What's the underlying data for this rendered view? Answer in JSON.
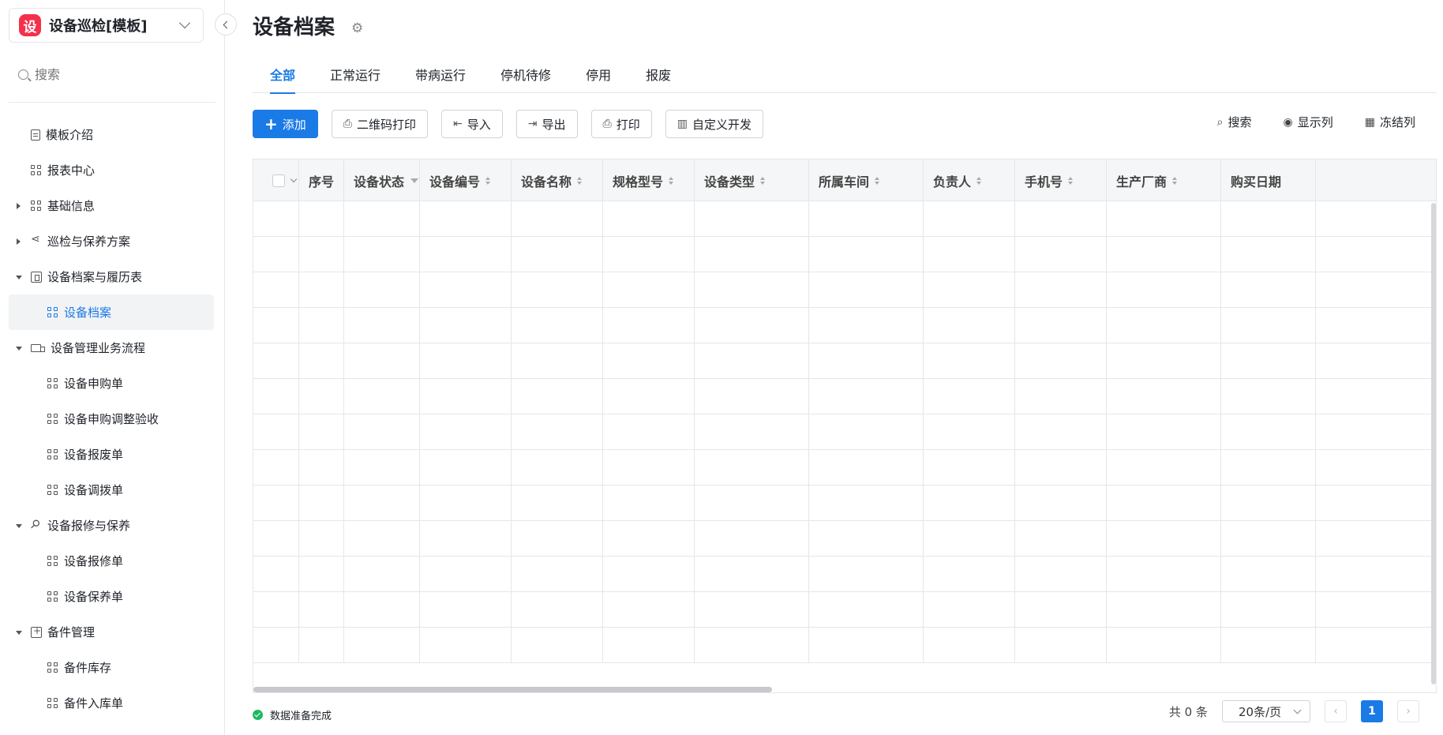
{
  "app": {
    "logo_glyph": "设",
    "name": "设备巡检[模板]",
    "brand_color": "#f5304a",
    "accent_color": "#1a7ae6"
  },
  "sidebar": {
    "search_placeholder": "搜索",
    "items": [
      {
        "label": "模板介绍",
        "level": 1,
        "icon": "document-icon",
        "expand": "none"
      },
      {
        "label": "报表中心",
        "level": 1,
        "icon": "grid-icon",
        "expand": "none"
      },
      {
        "label": "基础信息",
        "level": 1,
        "icon": "grid-icon",
        "expand": "collapsed"
      },
      {
        "label": "巡检与保养方案",
        "level": 1,
        "icon": "share-icon",
        "expand": "collapsed"
      },
      {
        "label": "设备档案与履历表",
        "level": 1,
        "icon": "file-icon",
        "expand": "expanded"
      },
      {
        "label": "设备档案",
        "level": 2,
        "icon": "grid-icon",
        "expand": "none",
        "active": true
      },
      {
        "label": "设备管理业务流程",
        "level": 1,
        "icon": "truck-icon",
        "expand": "expanded"
      },
      {
        "label": "设备申购单",
        "level": 2,
        "icon": "grid-icon",
        "expand": "none"
      },
      {
        "label": "设备申购调整验收",
        "level": 2,
        "icon": "grid-icon",
        "expand": "none"
      },
      {
        "label": "设备报废单",
        "level": 2,
        "icon": "grid-icon",
        "expand": "none"
      },
      {
        "label": "设备调拨单",
        "level": 2,
        "icon": "grid-icon",
        "expand": "none"
      },
      {
        "label": "设备报修与保养",
        "level": 1,
        "icon": "wrench-icon",
        "expand": "expanded"
      },
      {
        "label": "设备报修单",
        "level": 2,
        "icon": "grid-icon",
        "expand": "none"
      },
      {
        "label": "设备保养单",
        "level": 2,
        "icon": "grid-icon",
        "expand": "none"
      },
      {
        "label": "备件管理",
        "level": 1,
        "icon": "box-icon",
        "expand": "expanded"
      },
      {
        "label": "备件库存",
        "level": 2,
        "icon": "grid-icon",
        "expand": "none"
      },
      {
        "label": "备件入库单",
        "level": 2,
        "icon": "grid-icon",
        "expand": "none"
      }
    ]
  },
  "page": {
    "title": "设备档案",
    "tabs": [
      "全部",
      "正常运行",
      "带病运行",
      "停机待修",
      "停用",
      "报废"
    ],
    "active_tab": 0
  },
  "toolbar": {
    "add": "添加",
    "qr_print": "二维码打印",
    "import": "导入",
    "export": "导出",
    "print": "打印",
    "custom_dev": "自定义开发",
    "search": "搜索",
    "show_columns": "显示列",
    "freeze_columns": "冻结列"
  },
  "table": {
    "columns": [
      {
        "label": "",
        "width": 58,
        "kind": "checkbox"
      },
      {
        "label": "序号",
        "width": 57,
        "kind": "plain"
      },
      {
        "label": "设备状态",
        "width": 96,
        "kind": "filter"
      },
      {
        "label": "设备编号",
        "width": 116,
        "kind": "sort"
      },
      {
        "label": "设备名称",
        "width": 116,
        "kind": "sort"
      },
      {
        "label": "规格型号",
        "width": 116,
        "kind": "sort"
      },
      {
        "label": "设备类型",
        "width": 145,
        "kind": "sort"
      },
      {
        "label": "所属车间",
        "width": 145,
        "kind": "sort"
      },
      {
        "label": "负责人",
        "width": 116,
        "kind": "sort"
      },
      {
        "label": "手机号",
        "width": 116,
        "kind": "sort"
      },
      {
        "label": "生产厂商",
        "width": 145,
        "kind": "sort"
      },
      {
        "label": "购买日期",
        "width": 120,
        "kind": "plain"
      }
    ],
    "empty_rows": 13
  },
  "footer": {
    "status": "数据准备完成",
    "total": "共 0 条",
    "page_size": "20条/页",
    "current_page": "1"
  }
}
